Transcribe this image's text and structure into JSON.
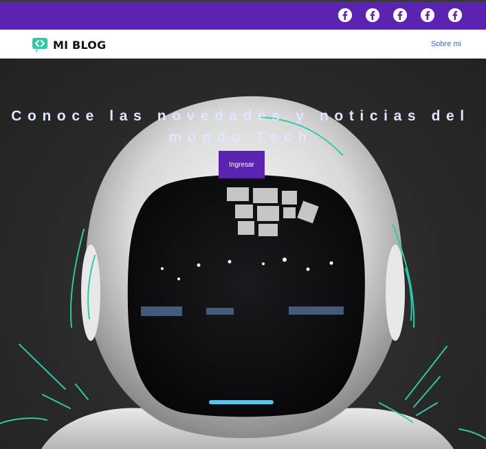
{
  "topbar": {
    "accent": "#5a24b0",
    "social_icons": [
      "facebook-icon",
      "facebook-icon",
      "facebook-icon",
      "facebook-icon",
      "facebook-icon"
    ]
  },
  "navbar": {
    "logo_text": "MI BLOG",
    "logo_icon": "code-brackets-icon",
    "links": [
      {
        "label": "Sobre mi"
      }
    ]
  },
  "hero": {
    "title": "Conoce las novedades y noticias del mundo Tech",
    "button_label": "Ingresar",
    "background_image": "astronaut-helmet-image"
  }
}
